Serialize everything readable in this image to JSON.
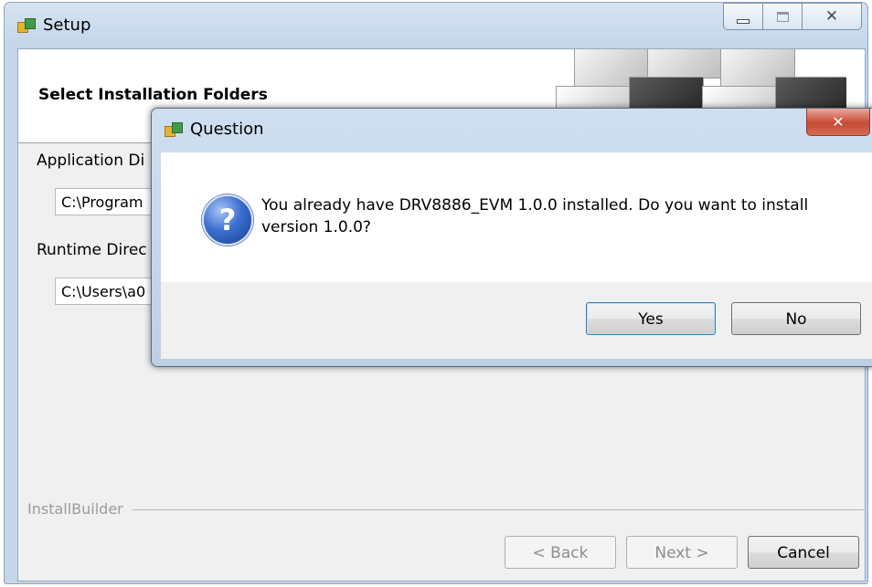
{
  "setup_window": {
    "title": "Setup",
    "header_title": "Select Installation Folders",
    "application_dir_label": "Application Di",
    "application_dir_value": "C:\\Program",
    "runtime_dir_label": "Runtime Direc",
    "runtime_dir_value": "C:\\Users\\a0",
    "brand": "InstallBuilder",
    "buttons": {
      "back": "< Back",
      "next": "Next >",
      "cancel": "Cancel"
    }
  },
  "dialog": {
    "title": "Question",
    "message": "You already have DRV8886_EVM 1.0.0 installed. Do you want to install version 1.0.0?",
    "buttons": {
      "yes": "Yes",
      "no": "No"
    }
  },
  "icons": {
    "app": "setup-app-icon",
    "question": "question-icon",
    "minimize": "minimize-icon",
    "maximize": "maximize-icon",
    "close": "close-icon"
  },
  "colors": {
    "window_frame": "#c4d6ea",
    "dialog_frame": "#bcd0e6",
    "close_button": "#c74a34",
    "question_icon": "#3c6fd0"
  }
}
